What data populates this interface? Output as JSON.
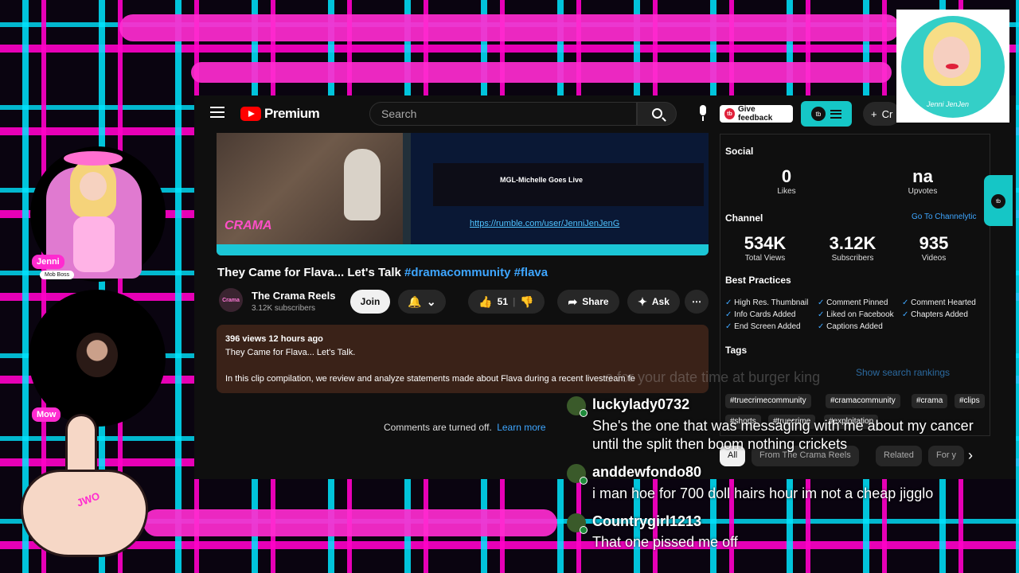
{
  "youtube": {
    "search_placeholder": "Search",
    "logo_text": "Premium",
    "feedback_label": "Give feedback",
    "tb_label": "tb",
    "create_label": "Cr",
    "video": {
      "overlay_label": "MGL-Michelle Goes Live",
      "rumble_url": "https://rumble.com/user/JenniJenJenG",
      "brand": "CRAMA"
    },
    "title_text": "They Came for Flava... Let's Talk",
    "title_tags": "#dramacommunity #flava",
    "channel": {
      "avatar_text": "Crama",
      "name": "The Crama Reels",
      "subscribers": "3.12K subscribers",
      "join_label": "Join"
    },
    "actions": {
      "likes": "51",
      "share": "Share",
      "ask": "Ask",
      "more": "⋯"
    },
    "description": {
      "meta": "396 views  12 hours ago",
      "line1": "They Came for Flava... Let's Talk.",
      "line2": "In this clip compilation, we review and analyze statements made about Flava during a recent livestream fe"
    },
    "comments_off": "Comments are turned off.",
    "learn_more": "Learn more",
    "panel": {
      "social_label": "Social",
      "likes_value": "0",
      "likes_label": "Likes",
      "upvotes_value": "na",
      "upvotes_label": "Upvotes",
      "channel_label": "Channel",
      "go_link": "Go To Channelytic",
      "total_views_value": "534K",
      "total_views_label": "Total Views",
      "subs_value": "3.12K",
      "subs_label": "Subscribers",
      "videos_value": "935",
      "videos_label": "Videos",
      "best_practices_label": "Best Practices",
      "practices": [
        "High Res. Thumbnail",
        "Comment Pinned",
        "Comment Hearted",
        "Info Cards Added",
        "Liked on Facebook",
        "Chapters Added",
        "End Screen Added",
        "Captions Added"
      ],
      "tags_label": "Tags",
      "show_rankings": "Show search rankings",
      "tags": [
        "#truecrimecommunity",
        "#cramacommunity",
        "#crama",
        "#clips",
        "#shorts",
        "#truecrime",
        "#exploitation"
      ]
    },
    "filters": [
      "All",
      "From The Crama Reels",
      "Related",
      "For y"
    ]
  },
  "overlay": {
    "jenni_name": "Jenni",
    "jenni_role": "Mob Boss",
    "mow_name": "Mow",
    "hand_text": "JWO",
    "sticker_signature": "Jenni JenJen"
  },
  "ghost_text": "e for your date time at burger king",
  "chat": [
    {
      "user": "luckylady0732",
      "message": "She's the one that was messaging with me about my cancer until the split then boom nothing crickets"
    },
    {
      "user": "anddewfondo80",
      "message": "i man hoe for 700 doll hairs hour im not a cheap jigglo"
    },
    {
      "user": "Countrygirl1213",
      "message": "That one pissed me off"
    }
  ],
  "colors": {
    "accent_pink": "#ff2bd0",
    "accent_cyan": "#00e5ff",
    "youtube_red": "#ff0000",
    "link_blue": "#3ea6ff",
    "tb_teal": "#15c6c6"
  }
}
